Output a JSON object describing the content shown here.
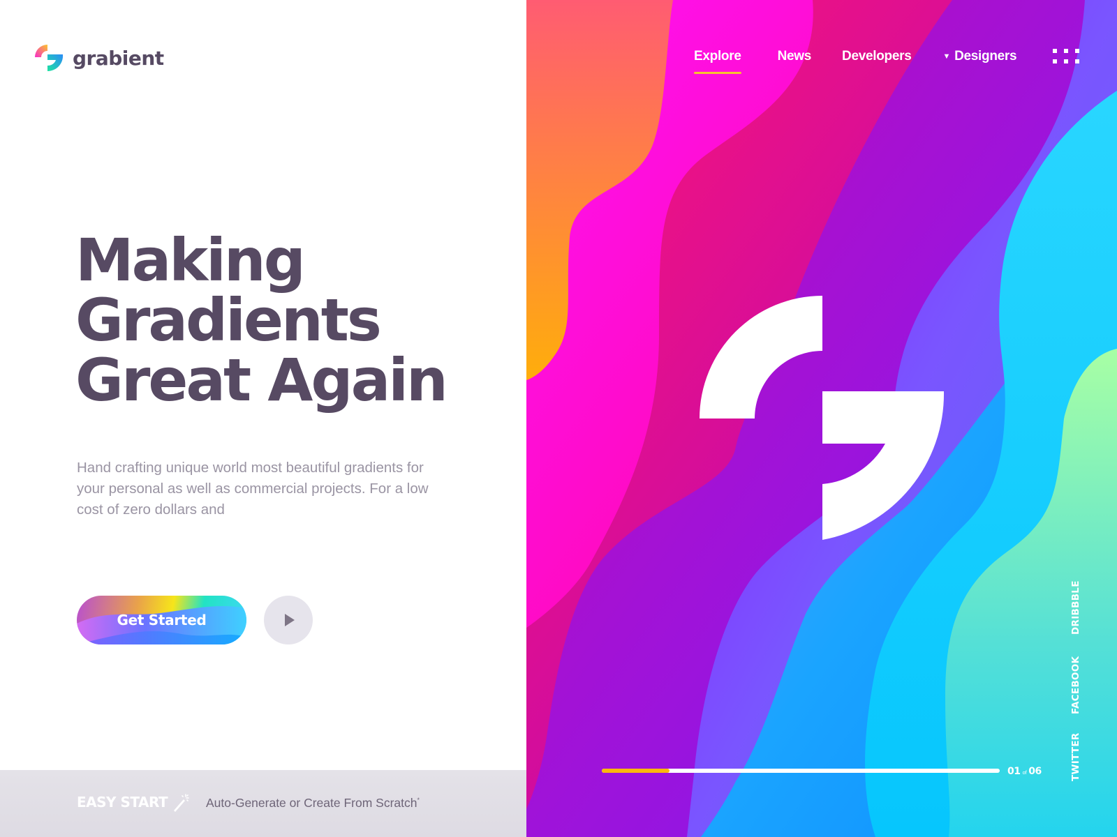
{
  "brand": {
    "name": "grabient",
    "logo_icon": "grabient-g-logo-icon"
  },
  "nav": {
    "items": [
      {
        "label": "Explore",
        "active": true
      },
      {
        "label": "News",
        "active": false
      },
      {
        "label": "Developers",
        "active": false
      },
      {
        "label": "Designers",
        "active": false,
        "has_dropdown": true
      }
    ],
    "menu_icon": "grid-dots-icon"
  },
  "hero": {
    "headline": [
      "Making",
      "Gradients",
      "Great Again"
    ],
    "description": "Hand crafting unique world most beautiful gradients for your personal as well as commercial projects. For a low cost of zero dollars and",
    "cta_label": "Get Started",
    "play_icon": "play-icon"
  },
  "footer_bar": {
    "easy_start": "EASY START",
    "wand_icon": "magic-wand-icon",
    "tagline": "Auto-Generate or Create From Scratch",
    "tagline_mark": "*"
  },
  "slider": {
    "current": "01",
    "separator": "of",
    "total": "06",
    "progress_fraction": 0.17
  },
  "social": [
    "TWITTER",
    "FACEBOOK",
    "DRIBBBLE"
  ],
  "colors": {
    "heading": "#574a63",
    "body_text": "#9a94a3",
    "accent_underline": "#f7c12f",
    "progress_fill": "#fbb80c",
    "bottom_bar": "#e2e0e6"
  }
}
